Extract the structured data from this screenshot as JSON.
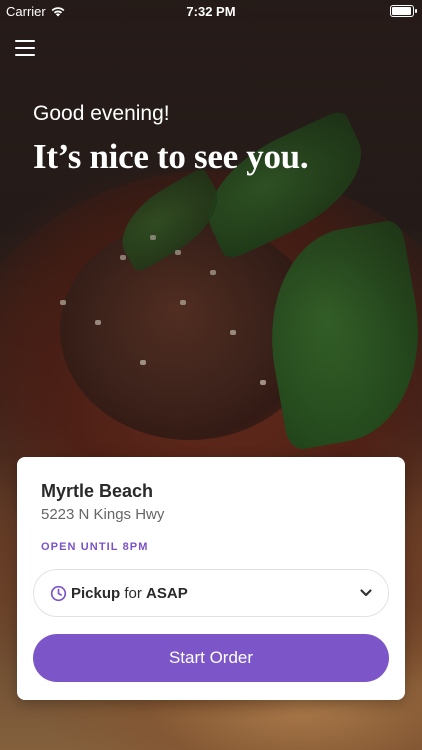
{
  "status_bar": {
    "carrier": "Carrier",
    "time": "7:32 PM"
  },
  "greeting": "Good evening!",
  "headline": "It’s nice to see you.",
  "location": {
    "name": "Myrtle Beach",
    "address": "5223 N Kings Hwy",
    "hours": "OPEN UNTIL 8PM"
  },
  "order_selector": {
    "mode": "Pickup",
    "connector": "for",
    "time": "ASAP"
  },
  "start_order_label": "Start Order",
  "colors": {
    "accent": "#7c56c8",
    "hours_text": "#7a52c5"
  },
  "icons": [
    "wifi-icon",
    "battery-icon",
    "menu-icon",
    "clock-icon",
    "chevron-down-icon"
  ]
}
